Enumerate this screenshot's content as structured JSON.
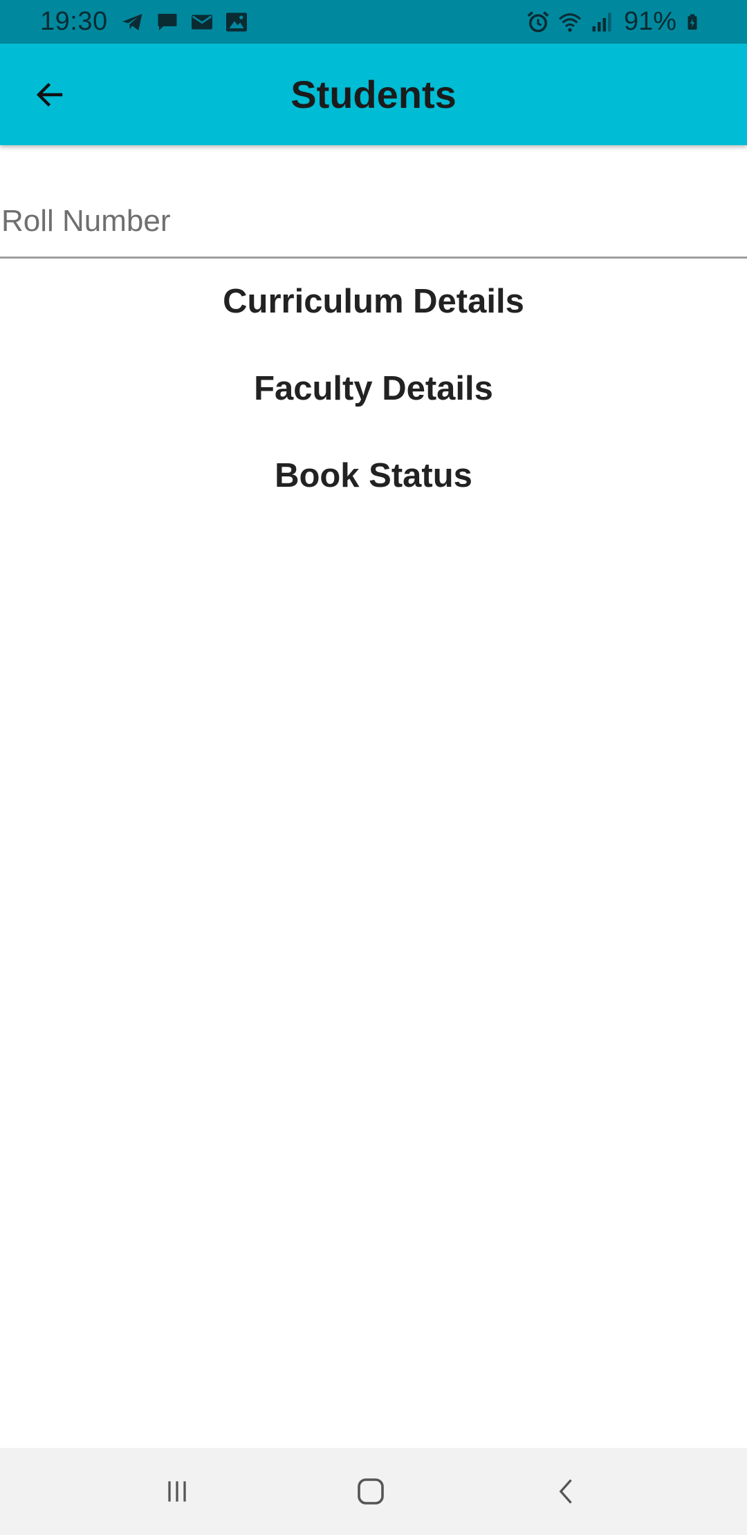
{
  "status_bar": {
    "time": "19:30",
    "battery": "91%",
    "left_icons": [
      "telegram-icon",
      "chat-icon",
      "email-icon",
      "gallery-icon"
    ],
    "right_icons": [
      "alarm-icon",
      "wifi-icon",
      "signal-icon",
      "battery-charging-icon"
    ]
  },
  "app_bar": {
    "title": "Students",
    "color": "#00bcd4",
    "back_icon": "arrow-back-icon"
  },
  "form": {
    "roll_placeholder": "Roll Number",
    "roll_value": ""
  },
  "options": [
    {
      "label": "Curriculum Details"
    },
    {
      "label": "Faculty Details"
    },
    {
      "label": "Book Status"
    }
  ],
  "nav_bar": {
    "buttons": [
      "recent-apps-icon",
      "home-icon",
      "back-icon"
    ]
  }
}
